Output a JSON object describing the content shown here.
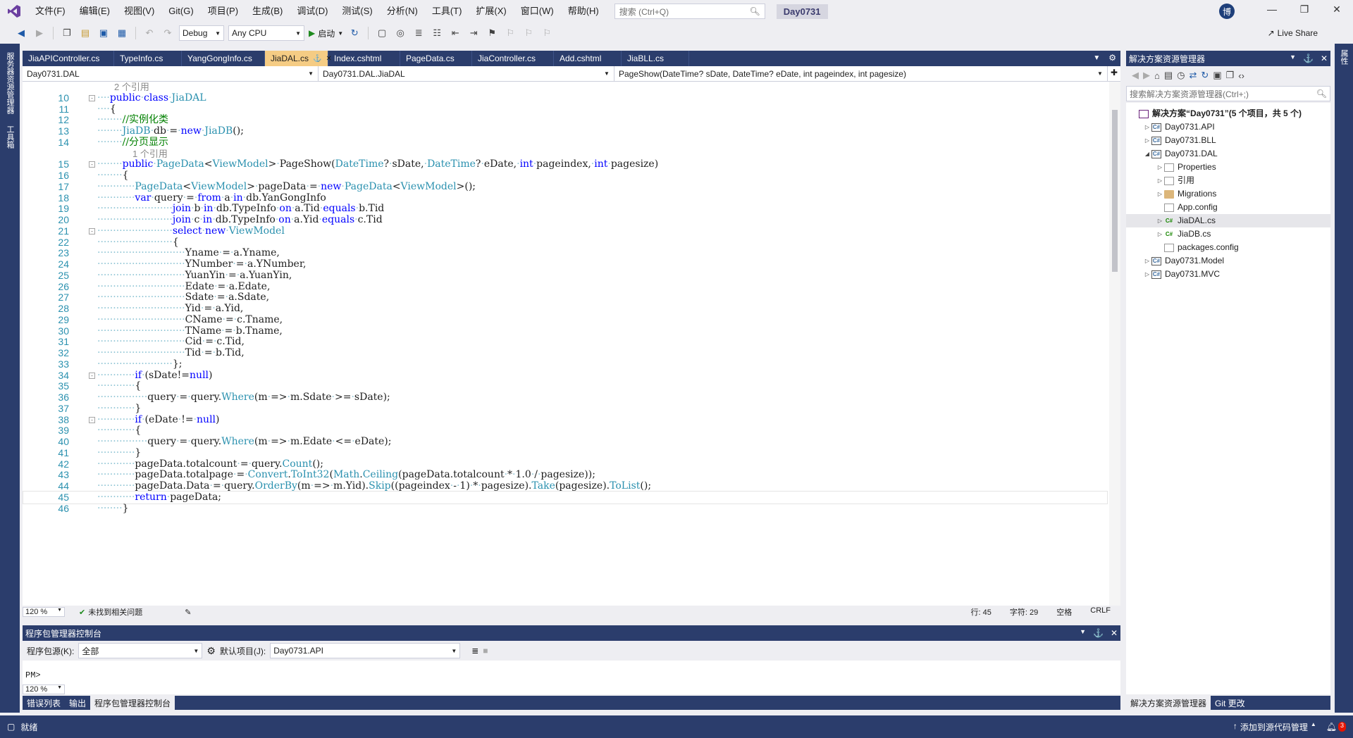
{
  "menubar": {
    "items": [
      "文件(F)",
      "编辑(E)",
      "视图(V)",
      "Git(G)",
      "项目(P)",
      "生成(B)",
      "调试(D)",
      "测试(S)",
      "分析(N)",
      "工具(T)",
      "扩展(X)",
      "窗口(W)",
      "帮助(H)"
    ],
    "search_placeholder": "搜索 (Ctrl+Q)",
    "project_name": "Day0731",
    "avatar_letter": "博"
  },
  "toolbar": {
    "config": "Debug",
    "platform": "Any CPU",
    "start_label": "启动",
    "live_share": "Live Share"
  },
  "left_strip": {
    "tab1": "服务器资源管理器",
    "tab2": "工具箱"
  },
  "right_strip": {
    "tab1": "属性"
  },
  "doc_tabs": [
    {
      "label": "JiaAPIController.cs",
      "active": false
    },
    {
      "label": "TypeInfo.cs",
      "active": false
    },
    {
      "label": "YangGongInfo.cs",
      "active": false
    },
    {
      "label": "JiaDAL.cs",
      "active": true
    },
    {
      "label": "Index.cshtml",
      "active": false
    },
    {
      "label": "PageData.cs",
      "active": false
    },
    {
      "label": "JiaController.cs",
      "active": false
    },
    {
      "label": "Add.cshtml",
      "active": false
    },
    {
      "label": "JiaBLL.cs",
      "active": false
    }
  ],
  "navbar": {
    "project": "Day0731.DAL",
    "class": "Day0731.DAL.JiaDAL",
    "member": "PageShow(DateTime? sDate, DateTime? eDate, int pageindex, int pagesize)"
  },
  "editor": {
    "refs_2": "2 个引用",
    "refs_1": "1 个引用",
    "lines": [
      {
        "n": "10",
        "fold": "⊟"
      },
      {
        "n": "11"
      },
      {
        "n": "12"
      },
      {
        "n": "13"
      },
      {
        "n": "14"
      },
      {
        "n": "15",
        "fold": "⊟"
      },
      {
        "n": "16"
      },
      {
        "n": "17"
      },
      {
        "n": "18"
      },
      {
        "n": "19"
      },
      {
        "n": "20"
      },
      {
        "n": "21",
        "fold": "⊟"
      },
      {
        "n": "22"
      },
      {
        "n": "23"
      },
      {
        "n": "24"
      },
      {
        "n": "25"
      },
      {
        "n": "26"
      },
      {
        "n": "27"
      },
      {
        "n": "28"
      },
      {
        "n": "29"
      },
      {
        "n": "30"
      },
      {
        "n": "31"
      },
      {
        "n": "32"
      },
      {
        "n": "33"
      },
      {
        "n": "34",
        "fold": "⊟"
      },
      {
        "n": "35"
      },
      {
        "n": "36"
      },
      {
        "n": "37"
      },
      {
        "n": "38",
        "fold": "⊟"
      },
      {
        "n": "39"
      },
      {
        "n": "40"
      },
      {
        "n": "41"
      },
      {
        "n": "42"
      },
      {
        "n": "43"
      },
      {
        "n": "44"
      },
      {
        "n": "45"
      },
      {
        "n": "46"
      }
    ]
  },
  "editor_status": {
    "zoom": "120 %",
    "issues": "未找到相关问题",
    "line": "行: 45",
    "char": "字符: 29",
    "ws": "空格",
    "eol": "CRLF"
  },
  "pm": {
    "title": "程序包管理器控制台",
    "source_label": "程序包源(K):",
    "source_value": "全部",
    "default_project_label": "默认项目(J):",
    "default_project_value": "Day0731.API",
    "prompt": "PM>",
    "zoom": "120 %"
  },
  "bottom_tabs": [
    "错误列表",
    "输出",
    "程序包管理器控制台"
  ],
  "solution_explorer": {
    "title": "解决方案资源管理器",
    "search_placeholder": "搜索解决方案资源管理器(Ctrl+;)",
    "items": [
      {
        "label": "解决方案“Day0731”(5 个项目，共 5 个)",
        "depth": 0,
        "arrow": "",
        "icon": "sln",
        "bold": true
      },
      {
        "label": "Day0731.API",
        "depth": 1,
        "arrow": "▷",
        "icon": "proj"
      },
      {
        "label": "Day0731.BLL",
        "depth": 1,
        "arrow": "▷",
        "icon": "proj"
      },
      {
        "label": "Day0731.DAL",
        "depth": 1,
        "arrow": "◢",
        "icon": "proj"
      },
      {
        "label": "Properties",
        "depth": 2,
        "arrow": "▷",
        "icon": "cfg"
      },
      {
        "label": "引用",
        "depth": 2,
        "arrow": "▷",
        "icon": "cfg"
      },
      {
        "label": "Migrations",
        "depth": 2,
        "arrow": "▷",
        "icon": "folder"
      },
      {
        "label": "App.config",
        "depth": 2,
        "arrow": "",
        "icon": "cfg"
      },
      {
        "label": "JiaDAL.cs",
        "depth": 2,
        "arrow": "▷",
        "icon": "cs",
        "selected": true
      },
      {
        "label": "JiaDB.cs",
        "depth": 2,
        "arrow": "▷",
        "icon": "cs"
      },
      {
        "label": "packages.config",
        "depth": 2,
        "arrow": "",
        "icon": "cfg"
      },
      {
        "label": "Day0731.Model",
        "depth": 1,
        "arrow": "▷",
        "icon": "proj"
      },
      {
        "label": "Day0731.MVC",
        "depth": 1,
        "arrow": "▷",
        "icon": "proj"
      }
    ],
    "bottom_tabs": [
      "解决方案资源管理器",
      "Git 更改"
    ]
  },
  "statusbar": {
    "ready": "就绪",
    "source_control": "添加到源代码管理",
    "notifications": "3"
  }
}
